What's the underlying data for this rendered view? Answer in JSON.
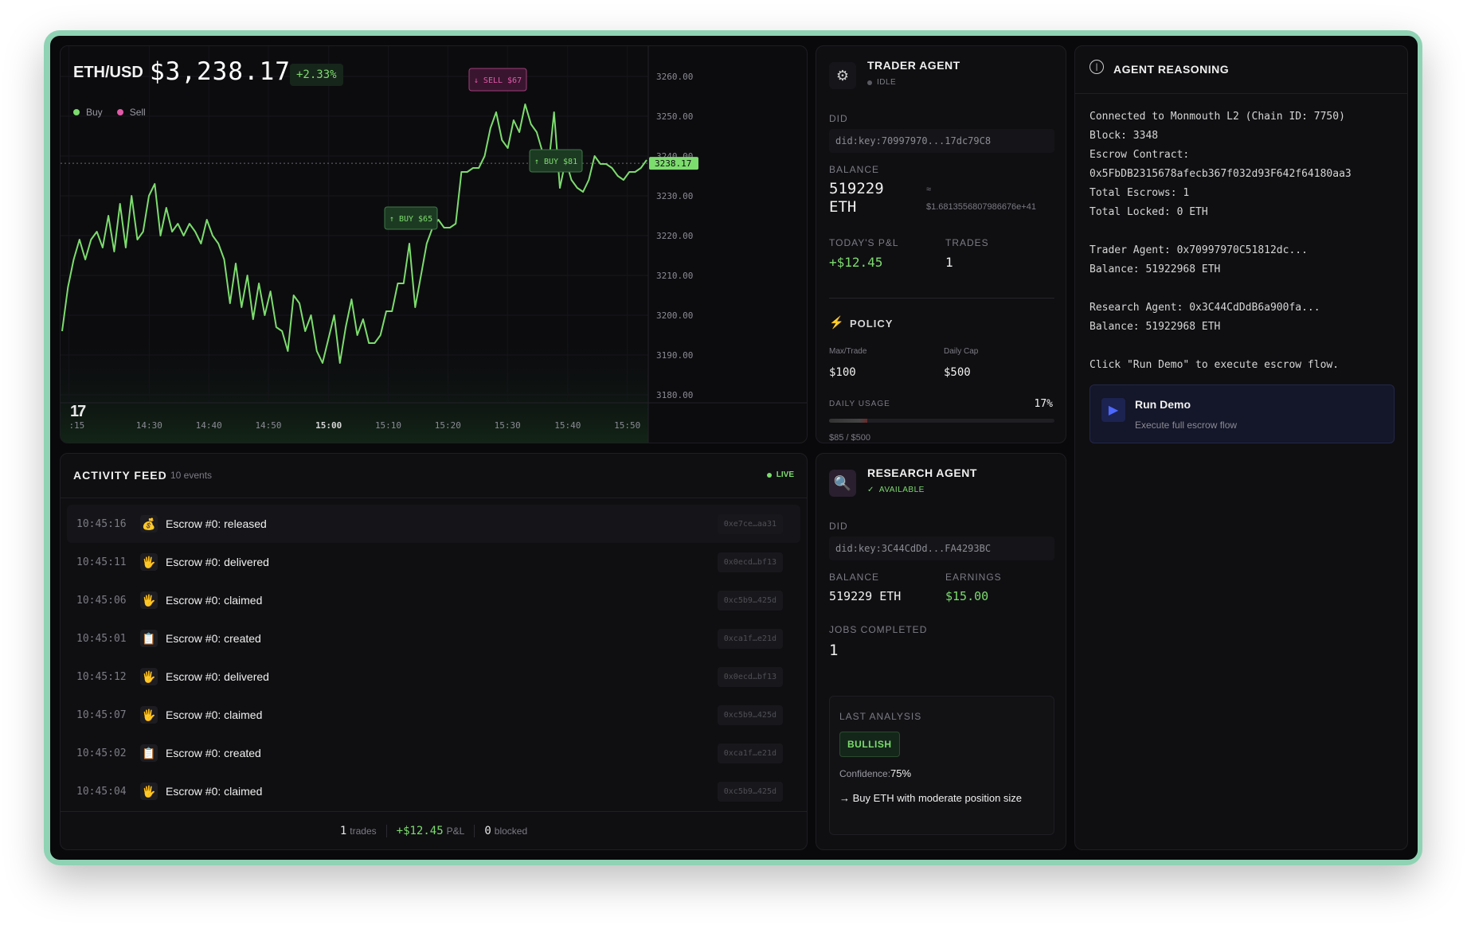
{
  "chart": {
    "pair": "ETH/USD",
    "price": "$3,238.17",
    "change": "+2.33%",
    "legend": [
      {
        "label": "Buy",
        "color": "#7ddc6e"
      },
      {
        "label": "Sell",
        "color": "#e05aa8"
      }
    ],
    "current_price_tag": "3238.17",
    "markers": [
      {
        "label": "↓ SELL $67",
        "type": "sell"
      },
      {
        "label": "↑ BUY $81",
        "type": "buy"
      },
      {
        "label": "↑ BUY $65",
        "type": "buy"
      }
    ]
  },
  "chart_data": {
    "type": "line",
    "x_ticks": [
      ":15",
      "14:30",
      "14:40",
      "14:50",
      "15:00",
      "15:10",
      "15:20",
      "15:30",
      "15:40",
      "15:50"
    ],
    "y_ticks": [
      "3260.00",
      "3250.00",
      "3240.00",
      "3230.00",
      "3220.00",
      "3210.00",
      "3200.00",
      "3190.00",
      "3180.00"
    ],
    "ylim": [
      3178,
      3262
    ],
    "y_values": [
      3196,
      3207,
      3214,
      3219,
      3214,
      3219,
      3221,
      3217,
      3225,
      3216,
      3228,
      3217,
      3230,
      3219,
      3221,
      3230,
      3233,
      3220,
      3227,
      3221,
      3223,
      3220,
      3223,
      3221,
      3218,
      3224,
      3220,
      3218,
      3214,
      3203,
      3213,
      3202,
      3210,
      3199,
      3208,
      3200,
      3206,
      3197,
      3196,
      3191,
      3205,
      3203,
      3196,
      3200,
      3191,
      3188,
      3194,
      3200,
      3188,
      3197,
      3204,
      3195,
      3199,
      3193,
      3193,
      3195,
      3201,
      3201,
      3208,
      3208,
      3218,
      3202,
      3210,
      3218,
      3222,
      3224,
      3222,
      3222,
      3223,
      3236,
      3236,
      3237,
      3237,
      3240,
      3247,
      3251,
      3244,
      3242,
      3249,
      3246,
      3253,
      3248,
      3246,
      3241,
      3237,
      3251,
      3232,
      3239,
      3234,
      3232,
      3231,
      3234,
      3240,
      3238,
      3238,
      3237,
      3235,
      3234,
      3236,
      3236,
      3237,
      3239
    ]
  },
  "activity": {
    "title": "ACTIVITY FEED",
    "count": "10 events",
    "live": "LIVE",
    "rows": [
      {
        "time": "10:45:16",
        "icon": "💰",
        "text": "Escrow #0: released",
        "hash": "0xe7ce…aa31"
      },
      {
        "time": "10:45:11",
        "icon": "🖐",
        "text": "Escrow #0: delivered",
        "hash": "0x0ecd…bf13"
      },
      {
        "time": "10:45:06",
        "icon": "🖐",
        "text": "Escrow #0: claimed",
        "hash": "0xc5b9…425d"
      },
      {
        "time": "10:45:01",
        "icon": "📋",
        "text": "Escrow #0: created",
        "hash": "0xca1f…e21d"
      },
      {
        "time": "10:45:12",
        "icon": "🖐",
        "text": "Escrow #0: delivered",
        "hash": "0x0ecd…bf13"
      },
      {
        "time": "10:45:07",
        "icon": "🖐",
        "text": "Escrow #0: claimed",
        "hash": "0xc5b9…425d"
      },
      {
        "time": "10:45:02",
        "icon": "📋",
        "text": "Escrow #0: created",
        "hash": "0xca1f…e21d"
      },
      {
        "time": "10:45:04",
        "icon": "🖐",
        "text": "Escrow #0: claimed",
        "hash": "0xc5b9…425d"
      }
    ],
    "footer": {
      "trades_count": "1",
      "trades_label": "trades",
      "pnl": "+$12.45",
      "pnl_label": "P&L",
      "blocked_count": "0",
      "blocked_label": "blocked"
    }
  },
  "trader": {
    "title": "TRADER AGENT",
    "status": "IDLE",
    "did_label": "DID",
    "did": "did:key:70997970...17dc79C8",
    "balance_label": "BALANCE",
    "balance_line1": "519229",
    "balance_line2": "ETH",
    "balance_approx": "≈",
    "balance_usd": "$1.6813556807986676e+41",
    "pnl_label": "TODAY'S P&L",
    "pnl": "+$12.45",
    "trades_label": "TRADES",
    "trades": "1",
    "policy_label": "POLICY",
    "max_trade_label": "Max/Trade",
    "max_trade": "$100",
    "daily_cap_label": "Daily Cap",
    "daily_cap": "$500",
    "daily_usage_label": "DAILY USAGE",
    "daily_usage_pct": "17%",
    "daily_usage_value": 0.17,
    "usage_text": "$85 / $500"
  },
  "research": {
    "title": "RESEARCH AGENT",
    "status": "AVAILABLE",
    "did_label": "DID",
    "did": "did:key:3C44CdDd...FA4293BC",
    "balance_label": "BALANCE",
    "balance": "519229 ETH",
    "earnings_label": "EARNINGS",
    "earnings": "$15.00",
    "jobs_label": "JOBS COMPLETED",
    "jobs": "1",
    "last_analysis_label": "LAST ANALYSIS",
    "analysis_badge": "BULLISH",
    "confidence_label": "Confidence:",
    "confidence": "75%",
    "recommendation": "→ Buy ETH with moderate position size"
  },
  "reasoning": {
    "title": "AGENT REASONING",
    "lines": [
      "Connected to Monmouth L2 (Chain ID: 7750)",
      "Block: 3348",
      "Escrow Contract:",
      "0x5FbDB2315678afecb367f032d93F642f64180aa3",
      "Total Escrows: 1",
      "Total Locked: 0 ETH",
      "",
      "Trader Agent: 0x70997970C51812dc...",
      "Balance: 51922968 ETH",
      "",
      "Research Agent: 0x3C44CdDdB6a900fa...",
      "Balance: 51922968 ETH",
      "",
      "Click \"Run Demo\" to execute escrow flow."
    ],
    "run_demo_title": "Run Demo",
    "run_demo_sub": "Execute full escrow flow"
  }
}
